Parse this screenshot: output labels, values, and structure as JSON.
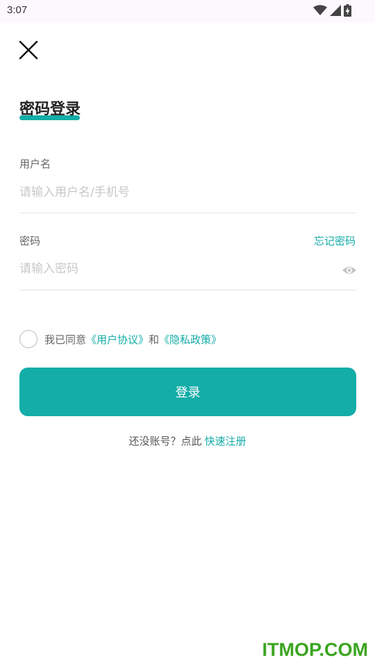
{
  "status_bar": {
    "time": "3:07",
    "icons": [
      "wifi-icon",
      "signal-icon",
      "battery-charging-icon"
    ]
  },
  "header": {
    "close_icon": "close-icon",
    "title": "密码登录"
  },
  "form": {
    "username": {
      "label": "用户名",
      "value": "",
      "placeholder": "请输入用户名/手机号"
    },
    "password": {
      "label": "密码",
      "value": "",
      "placeholder": "请输入密码",
      "forgot_label": "忘记密码",
      "visibility_icon": "eye-icon"
    }
  },
  "agreement": {
    "prefix": "我已同意",
    "user_agreement": "《用户协议》",
    "conjunction": "和",
    "privacy_policy": "《隐私政策》",
    "checked": false
  },
  "login_button": {
    "label": "登录"
  },
  "register": {
    "prompt": "还没账号？点此",
    "link": "快速注册"
  },
  "watermark": "ITMOP.COM",
  "colors": {
    "accent": "#14ada8",
    "watermark": "#3aa520"
  }
}
